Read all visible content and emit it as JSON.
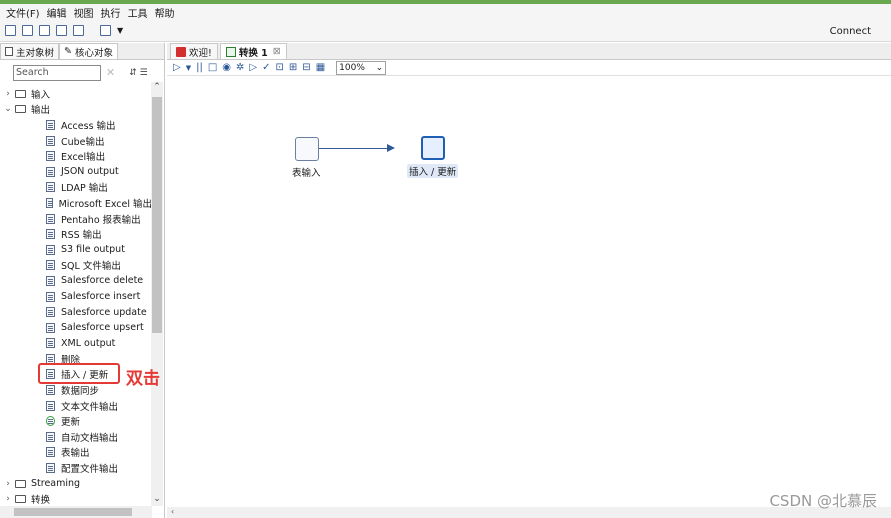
{
  "menu": [
    "文件(F)",
    "编辑",
    "视图",
    "执行",
    "工具",
    "帮助"
  ],
  "toolbar": {
    "connect_label": "Connect"
  },
  "left_tabs": [
    {
      "label": "主对象树",
      "active": false
    },
    {
      "label": "核心对象",
      "active": true
    }
  ],
  "search": {
    "placeholder": "Search",
    "value": "Search"
  },
  "tree": {
    "input_folder": "输入",
    "output_folder": "输出",
    "output_items": [
      "Access 输出",
      "Cube输出",
      "Excel输出",
      "JSON output",
      "LDAP 输出",
      "Microsoft Excel 输出",
      "Pentaho 报表输出",
      "RSS 输出",
      "S3 file output",
      "SQL 文件输出",
      "Salesforce delete",
      "Salesforce insert",
      "Salesforce update",
      "Salesforce upsert",
      "XML output",
      "删除",
      "插入 / 更新",
      "数据同步",
      "文本文件输出",
      "更新",
      "自动文档输出",
      "表输出",
      "配置文件输出"
    ],
    "streaming_folder": "Streaming",
    "transform_folder": "转换"
  },
  "annotation": {
    "text": "双击",
    "highlighted_item": "插入 / 更新"
  },
  "right_tabs": [
    {
      "label": "欢迎!",
      "active": false
    },
    {
      "label": "转换 1",
      "active": true
    }
  ],
  "zoom": {
    "value": "100%"
  },
  "canvas": {
    "source_node": "表输入",
    "target_node": "插入 / 更新"
  },
  "watermark": "CSDN @北慕辰"
}
